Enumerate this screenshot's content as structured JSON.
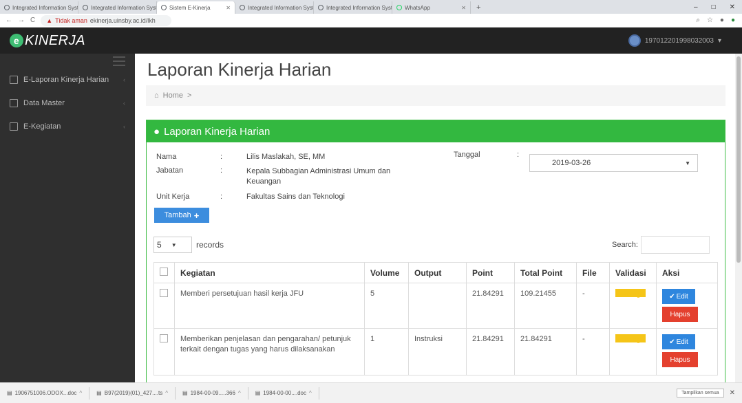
{
  "browser": {
    "tabs": [
      {
        "label": "Integrated Information System",
        "active": false
      },
      {
        "label": "Integrated Information System",
        "active": false
      },
      {
        "label": "Sistem E-Kinerja",
        "active": true
      },
      {
        "label": "Integrated Information System",
        "active": false
      },
      {
        "label": "Integrated Information System",
        "active": false
      },
      {
        "label": "WhatsApp",
        "active": false
      }
    ],
    "new_tab": "+",
    "window_controls": [
      "–",
      "□",
      "✕"
    ],
    "nav_back": "←",
    "nav_forward": "→",
    "nav_reload": "C",
    "security_text": "Tidak aman",
    "url": "ekinerja.uinsby.ac.id/lkh",
    "toolbar_icons": [
      "search-icon",
      "star-icon",
      "extension-icon",
      "profile-icon"
    ]
  },
  "app": {
    "brand": "KINERJA",
    "brand_initial": "e",
    "user_name": "197012201998032003",
    "user_caret": "▾"
  },
  "sidebar": {
    "items": [
      {
        "label": "E-Laporan Kinerja Harian",
        "chevron": "‹"
      },
      {
        "label": "Data Master",
        "chevron": "‹"
      },
      {
        "label": "E-Kegiatan",
        "chevron": "‹"
      }
    ]
  },
  "main": {
    "title": "Laporan Kinerja Harian",
    "breadcrumb": {
      "home": "Home",
      "sep": ">"
    },
    "panel_title": "Laporan Kinerja Harian",
    "info": {
      "nama_label": "Nama",
      "nama_value": "Lilis Maslakah, SE, MM",
      "jabatan_label": "Jabatan",
      "jabatan_value": "Kepala Subbagian Administrasi Umum dan Keuangan",
      "unit_label": "Unit Kerja",
      "unit_value": "Fakultas Sains dan Teknologi",
      "tanggal_label": "Tanggal",
      "tanggal_value": "2019-03-26",
      "sep": ":"
    },
    "add_button": "Tambah",
    "length": {
      "value": "5",
      "label": "records"
    },
    "search_label": "Search:",
    "table": {
      "columns": [
        "Kegiatan",
        "Volume",
        "Output",
        "Point",
        "Total Point",
        "File",
        "Validasi",
        "Aksi"
      ],
      "rows": [
        {
          "kegiatan": "Memberi persetujuan hasil kerja JFU",
          "volume": "5",
          "output": "",
          "point": "21.84291",
          "total": "109.21455",
          "file": "-",
          "validasi": "Pending"
        },
        {
          "kegiatan": "Memberikan penjelasan dan pengarahan/ petunjuk terkait dengan tugas yang harus dilaksanakan",
          "volume": "1",
          "output": "Instruksi",
          "point": "21.84291",
          "total": "21.84291",
          "file": "-",
          "validasi": "Pending"
        }
      ],
      "edit_label": "Edit",
      "hapus_label": "Hapus"
    }
  },
  "downloads": {
    "items": [
      "1906751006.ODOX...doc",
      "B97(2019)(01)_427....ts",
      "1984-00-09.....366",
      "1984-00-00....doc"
    ],
    "show_all": "Tampilkan semua",
    "close": "✕"
  },
  "colors": {
    "accent_green": "#33b840",
    "button_blue": "#3c8dde",
    "danger_red": "#e4402e",
    "pending_yellow": "#f5c518"
  }
}
